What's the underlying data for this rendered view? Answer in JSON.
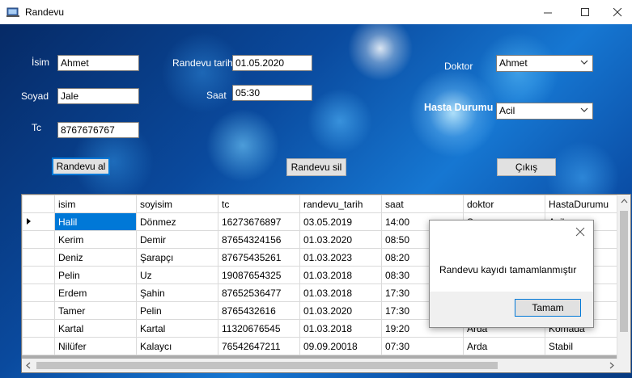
{
  "window": {
    "title": "Randevu"
  },
  "form": {
    "isim_label": "İsim",
    "isim_value": "Ahmet",
    "soyad_label": "Soyad",
    "soyad_value": "Jale",
    "tc_label": "Tc",
    "tc_value": "8767676767",
    "tarih_label": "Randevu tarihi",
    "tarih_value": "01.05.2020",
    "saat_label": "Saat",
    "saat_value": "05:30",
    "doktor_label": "Doktor",
    "doktor_value": "Ahmet",
    "durum_label": "Hasta Durumu",
    "durum_value": "Acil",
    "btn_randevu_al": "Randevu al",
    "btn_randevu_sil": "Randevu sil",
    "btn_cikis": "Çıkış"
  },
  "grid": {
    "columns": [
      "isim",
      "soyisim",
      "tc",
      "randevu_tarih",
      "saat",
      "doktor",
      "HastaDurumu"
    ],
    "rows": [
      [
        "Halil",
        "Dönmez",
        "16273676897",
        "03.05.2019",
        "14:00",
        "Sarpu",
        "Acil"
      ],
      [
        "Kerim",
        "Demir",
        "87654324156",
        "01.03.2020",
        "08:50",
        "",
        ""
      ],
      [
        "Deniz",
        "Şarapçı",
        "87675435261",
        "01.03.2023",
        "08:20",
        "",
        ""
      ],
      [
        "Pelin",
        "Uz",
        "19087654325",
        "01.03.2018",
        "08:30",
        "",
        ""
      ],
      [
        "Erdem",
        "Şahin",
        "87652536477",
        "01.03.2018",
        "17:30",
        "",
        ""
      ],
      [
        "Tamer",
        "Pelin",
        "8765432616",
        "01.03.2020",
        "17:30",
        "",
        ""
      ],
      [
        "Kartal",
        "Kartal",
        "11320676545",
        "01.03.2018",
        "19:20",
        "Arda",
        "Komada"
      ],
      [
        "Nilüfer",
        "Kalaycı",
        "76542647211",
        "09.09.20018",
        "07:30",
        "Arda",
        "Stabil"
      ]
    ]
  },
  "dialog": {
    "message": "Randevu kayıdı tamamlanmıştır",
    "ok_label": "Tamam"
  }
}
